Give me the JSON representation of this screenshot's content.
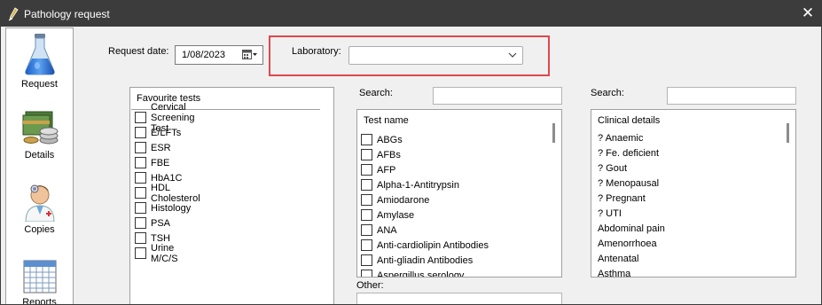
{
  "window": {
    "title": "Pathology request",
    "close_glyph": "✕"
  },
  "sidebar": {
    "items": [
      {
        "label": "Request",
        "icon": "flask-icon"
      },
      {
        "label": "Details",
        "icon": "money-icon"
      },
      {
        "label": "Copies",
        "icon": "doctor-icon"
      },
      {
        "label": "Reports",
        "icon": "calendar-icon"
      }
    ]
  },
  "request_date": {
    "label": "Request date:",
    "value": "1/08/2023"
  },
  "laboratory": {
    "label": "Laboratory:",
    "value": ""
  },
  "favourites": {
    "header": "Favourite tests",
    "items": [
      "Cervical Screening Test",
      "E/LFTs",
      "ESR",
      "FBE",
      "HbA1C",
      "HDL Cholesterol",
      "Histology",
      "PSA",
      "TSH",
      "Urine M/C/S"
    ]
  },
  "tests": {
    "search_label": "Search:",
    "search_value": "",
    "header": "Test name",
    "items": [
      "ABGs",
      "AFBs",
      "AFP",
      "Alpha-1-Antitrypsin",
      "Amiodarone",
      "Amylase",
      "ANA",
      "Anti-cardiolipin Antibodies",
      "Anti-gliadin Antibodies",
      "Aspergillus serology"
    ]
  },
  "clinical": {
    "search_label": "Search:",
    "search_value": "",
    "header": "Clinical details",
    "items": [
      "? Anaemic",
      "? Fe. deficient",
      "? Gout",
      "? Menopausal",
      "? Pregnant",
      "? UTI",
      "Abdominal pain",
      "Amenorrhoea",
      "Antenatal",
      "Asthma"
    ]
  },
  "other": {
    "label": "Other:",
    "value": ""
  },
  "colors": {
    "titlebar": "#3c3c3c",
    "highlight": "#e0484e"
  }
}
